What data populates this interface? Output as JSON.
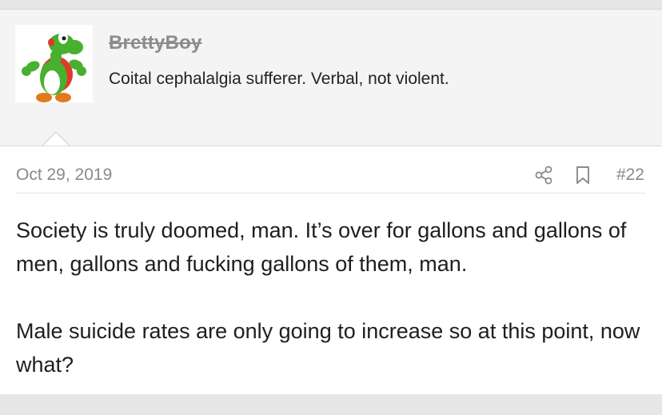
{
  "user": {
    "username": "BrettyBoy",
    "title": "Coital cephalalgia sufferer. Verbal, not violent."
  },
  "post": {
    "date": "Oct 29, 2019",
    "number": "#22",
    "paragraphs": [
      "Society is truly doomed, man. It’s over for gallons and gallons of men, gallons and fucking gallons of them, man.",
      "Male suicide rates are only going to increase so at this point, now what?"
    ]
  },
  "icons": {
    "share": "share-icon",
    "bookmark": "bookmark-icon"
  },
  "colors": {
    "username": "#8c8c8c",
    "meta": "#8a8a8a",
    "text": "#1e1e1e",
    "avatar_green": "#3fae2a"
  }
}
